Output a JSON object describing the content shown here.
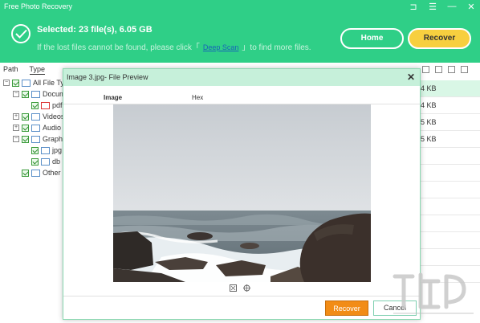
{
  "app": {
    "title": "Free Photo Recovery"
  },
  "window_controls": [
    "⊐",
    "☰",
    "—",
    "✕"
  ],
  "header": {
    "selected_text": "Selected: 23 file(s), 6.05 GB",
    "hint_prefix": "If the lost files cannot be found, please click「",
    "deep_scan_link": "Deep Scan",
    "hint_suffix": "」to find more files.",
    "home_button": "Home",
    "recover_button": "Recover"
  },
  "left_panel": {
    "tabs": [
      {
        "label": "Path"
      },
      {
        "label": "Type",
        "active": true
      }
    ],
    "tree": [
      {
        "label": "All File Typ",
        "level": 0,
        "toggle": "−",
        "icon": "folder"
      },
      {
        "label": "Docum",
        "level": 1,
        "toggle": "−",
        "icon": "doc"
      },
      {
        "label": "pdf",
        "level": 2,
        "toggle": "",
        "icon": "pdf"
      },
      {
        "label": "Videos",
        "level": 1,
        "toggle": "+",
        "icon": "video"
      },
      {
        "label": "Audio",
        "level": 1,
        "toggle": "+",
        "icon": "audio"
      },
      {
        "label": "Graphi",
        "level": 1,
        "toggle": "−",
        "icon": "image"
      },
      {
        "label": "jpg",
        "level": 2,
        "toggle": "",
        "icon": "image"
      },
      {
        "label": "db",
        "level": 2,
        "toggle": "",
        "icon": "file"
      },
      {
        "label": "Other",
        "level": 1,
        "toggle": "",
        "icon": "folder"
      }
    ]
  },
  "right_panel": {
    "rows": [
      {
        "text": "4 KB",
        "highlight": true
      },
      {
        "text": "4 KB",
        "highlight": false
      },
      {
        "text": "5 KB",
        "highlight": false
      },
      {
        "text": "5 KB",
        "highlight": false
      }
    ]
  },
  "dialog": {
    "title": "Image 3.jpg- File Preview",
    "close": "✕",
    "tabs": {
      "image": "Image",
      "hex": "Hex"
    },
    "recover_button": "Recover",
    "cancel_button": "Cancel"
  },
  "colors": {
    "header_bg": "#2fcf87",
    "recover_yellow": "#f7cf3f",
    "dialog_recover": "#f28c16",
    "dialog_title_bg": "#c6f0da"
  }
}
